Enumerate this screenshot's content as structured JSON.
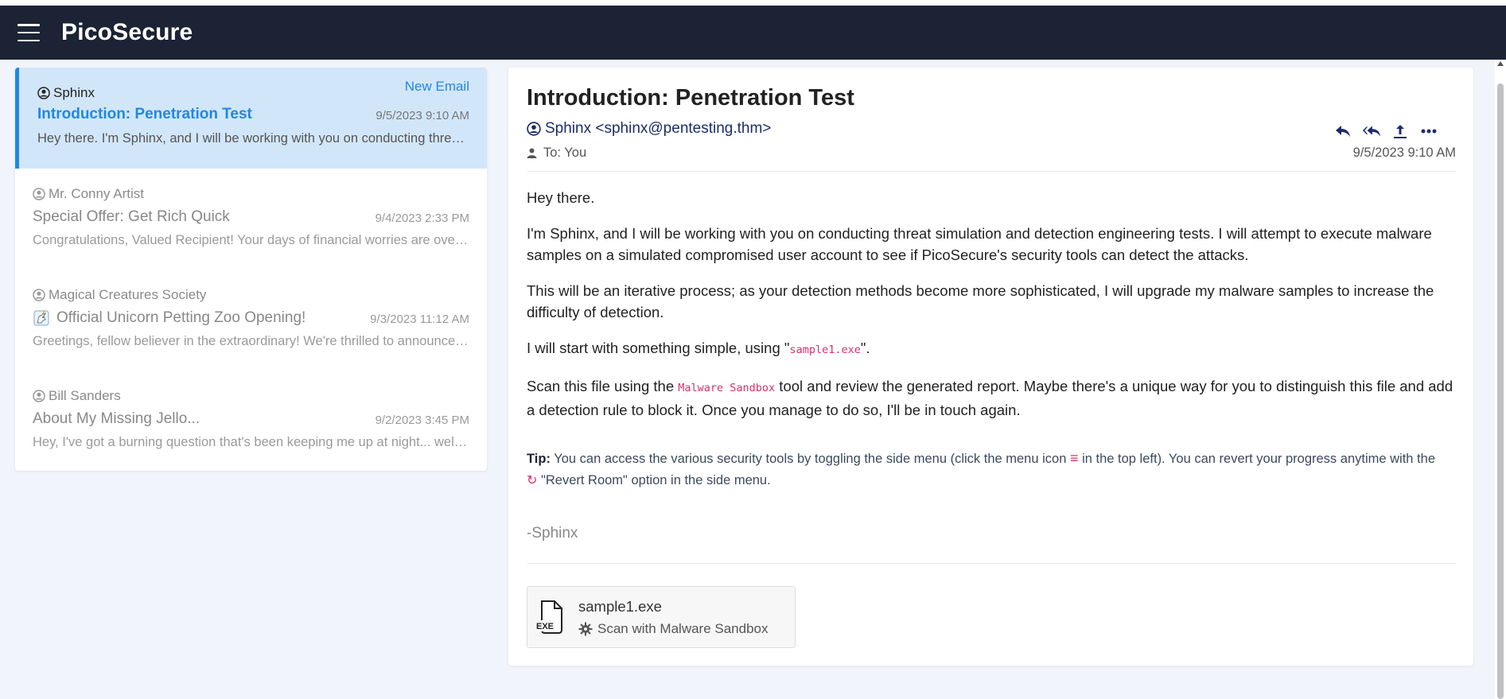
{
  "app": {
    "title": "PicoSecure",
    "menu_icon": "hamburger-menu-icon"
  },
  "colors": {
    "navbar": "#1b2335",
    "accent": "#1e88e5",
    "active_bg": "#d2e6f9",
    "code": "#d6336c"
  },
  "emails": [
    {
      "sender": "Sphinx",
      "badge": "New Email",
      "subject": "Introduction: Penetration Test",
      "date": "9/5/2023 9:10 AM",
      "preview": "Hey there. I'm Sphinx, and I will be working with you on conducting threat simulation and detection engineering tests.",
      "active": true
    },
    {
      "sender": "Mr. Conny Artist",
      "subject": "Special Offer: Get Rich Quick",
      "date": "9/4/2023 2:33 PM",
      "preview": "Congratulations, Valued Recipient! Your days of financial worries are over forever."
    },
    {
      "sender": "Magical Creatures Society",
      "subject": "Official Unicorn Petting Zoo Opening!",
      "subject_icon": "unicorn-icon",
      "date": "9/3/2023 11:12 AM",
      "preview": "Greetings, fellow believer in the extraordinary! We're thrilled to announce the opening."
    },
    {
      "sender": "Bill Sanders",
      "subject": "About My Missing Jello...",
      "date": "9/2/2023 3:45 PM",
      "preview": "Hey, I've got a burning question that's been keeping me up at night... well, sort of."
    }
  ],
  "reader": {
    "title": "Introduction: Penetration Test",
    "from": "Sphinx <sphinx@pentesting.thm>",
    "to": "To: You",
    "date": "9/5/2023 9:10 AM",
    "actions": [
      "reply-icon",
      "reply-all-icon",
      "share-icon",
      "more-icon"
    ],
    "body": {
      "p1": "Hey there.",
      "p2": "I'm Sphinx, and I will be working with you on conducting threat simulation and detection engineering tests. I will attempt to execute malware samples on a simulated compromised user account to see if PicoSecure's security tools can detect the attacks.",
      "p3": "This will be an iterative process; as your detection methods become more sophisticated, I will upgrade my malware samples to increase the difficulty of detection.",
      "p4_pre": "I will start with something simple, using \"",
      "p4_code": "sample1.exe",
      "p4_post": "\".",
      "p5_pre": "Scan this file using the ",
      "p5_code": "Malware Sandbox",
      "p5_post": " tool and review the generated report. Maybe there's a unique way for you to distinguish this file and add a detection rule to block it. Once you manage to do so, I'll be in touch again."
    },
    "tip": {
      "label": "Tip:",
      "text1": " You can access the various security tools by toggling the side menu (click the menu icon ",
      "text2": " in the top left). You can revert your progress anytime with the ",
      "text3": " \"Revert Room\" option in the side menu."
    },
    "signature": "-Sphinx",
    "attachment": {
      "filename": "sample1.exe",
      "file_label": "EXE",
      "action": "Scan with Malware Sandbox"
    }
  }
}
